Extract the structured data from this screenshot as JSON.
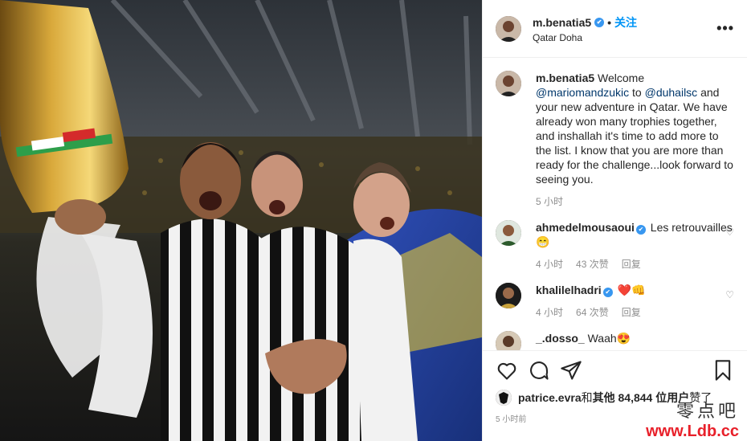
{
  "post": {
    "username": "m.benatia5",
    "verified_mark": "✔",
    "dot": "•",
    "follow_label": "关注",
    "location": "Qatar Doha",
    "more_label": "•••"
  },
  "caption": {
    "username": "m.benatia5",
    "text_start": " Welcome ",
    "mention1": "@mariomandzukic",
    "text_mid": " to ",
    "mention2": "@duhailsc",
    "text_end": " and your new adventure in Qatar. We have already won many trophies together, and inshallah it's time to add more to the list. I know that you are more than ready for the challenge...look forward to seeing you.",
    "time": "5 小时"
  },
  "comments": [
    {
      "username": "ahmedelmousaoui",
      "text": " Les retrouvailles 😁",
      "time": "4 小时",
      "likes": "43 次赞",
      "reply": "回复"
    },
    {
      "username": "khalilelhadri",
      "text": " ❤️👊",
      "time": "4 小时",
      "likes": "64 次赞",
      "reply": "回复"
    },
    {
      "username": "_.dosso_",
      "text": " Waah😍"
    }
  ],
  "likes_line": {
    "user": "patrice.evra",
    "connector": " 和 ",
    "others": "其他 84,844 位用户",
    "suffix": " 赞了"
  },
  "time_ago": "5 小时前",
  "watermark": {
    "line1": "零点吧",
    "line2": "www.Ldb.cc"
  },
  "icons": [
    "heart-icon",
    "comment-icon",
    "share-icon",
    "save-icon"
  ],
  "colors": {
    "accent": "#0095f6",
    "verified": "#3897f0",
    "watermark_red": "#e8202a"
  }
}
